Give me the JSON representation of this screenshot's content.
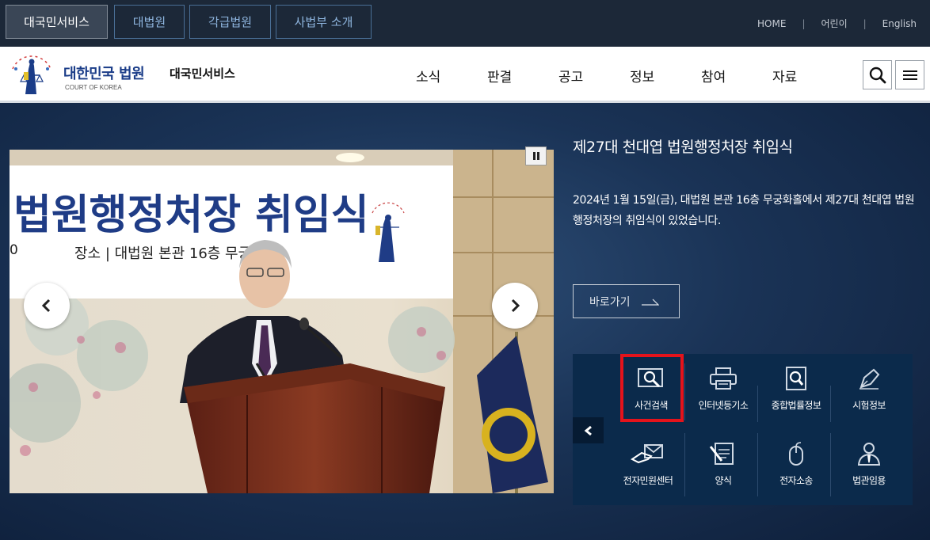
{
  "top_tabs": [
    "대국민서비스",
    "대법원",
    "각급법원",
    "사법부 소개"
  ],
  "util_links": [
    "HOME",
    "어린이",
    "English"
  ],
  "brand": {
    "name": "대한민국 법원",
    "sub": "COURT OF KOREA",
    "service": "대국민서비스"
  },
  "nav": [
    "소식",
    "판결",
    "공고",
    "정보",
    "참여",
    "자료"
  ],
  "photo": {
    "banner_title": "법원행정처장 취임식",
    "banner_place": "장소  |  대법원 본관 16층 무궁화홀",
    "banner_left_fragment": "0"
  },
  "news": {
    "title": "제27대 천대엽 법원행정처장 취임식",
    "desc": "2024년 1월 15일(금), 대법원 본관 16층 무궁화홀에서 제27대 천대엽 법원행정처장의 취임식이 있었습니다.",
    "goto": "바로가기"
  },
  "quick_menu": [
    {
      "label": "사건검색",
      "icon": "magnifier-monitor-icon"
    },
    {
      "label": "인터넷등기소",
      "icon": "printer-icon"
    },
    {
      "label": "종합법률정보",
      "icon": "document-search-icon"
    },
    {
      "label": "시험정보",
      "icon": "pen-icon"
    },
    {
      "label": "전자민원센터",
      "icon": "hand-envelope-icon"
    },
    {
      "label": "양식",
      "icon": "form-pencil-icon"
    },
    {
      "label": "전자소송",
      "icon": "mouse-icon"
    },
    {
      "label": "법관임용",
      "icon": "person-tie-icon"
    }
  ],
  "colors": {
    "topbar": "#1c2838",
    "brand_blue": "#1a3c88",
    "quick_bg": "#0b2a4b",
    "highlight": "#e5131b"
  }
}
